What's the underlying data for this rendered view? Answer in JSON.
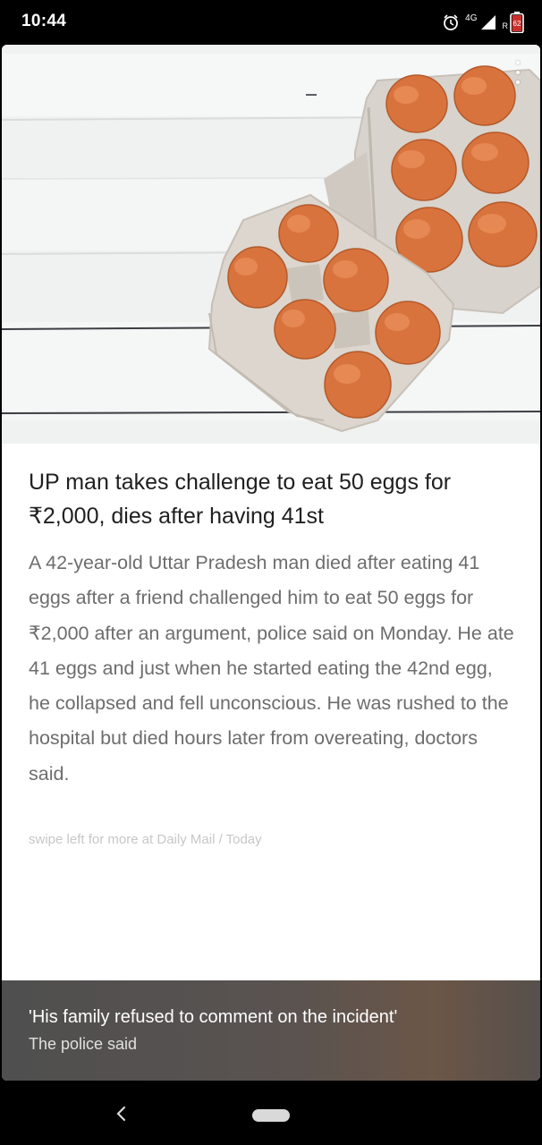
{
  "status_bar": {
    "time": "10:44",
    "network_label": "4G",
    "roaming_label": "R",
    "battery_level": "62",
    "icons": [
      "alarm-icon",
      "signal-icon",
      "battery-icon"
    ]
  },
  "article": {
    "image": {
      "description_icon": "eggs-in-carton-photo"
    },
    "headline": "UP man takes challenge to eat 50 eggs for ₹2,000, dies after having 41st",
    "body": "A 42-year-old Uttar Pradesh man died after eating 41 eggs after a friend challenged him to eat 50 eggs for ₹2,000 after an argument, police said on Monday. He ate 41 eggs and just when he started eating the 42nd egg, he collapsed and fell unconscious. He was rushed to the hospital but died hours later from overeating, doctors said.",
    "attribution": "swipe left for more at Daily Mail / Today"
  },
  "quote": {
    "text": "'His family refused to comment on the incident'",
    "source": "The police said"
  },
  "nav": {
    "icons": [
      "back-icon",
      "home-pill"
    ]
  },
  "colors": {
    "headline": "#202020",
    "body": "#6d6d6d",
    "attribution": "#c7c7c7",
    "quote_bg": "#555250",
    "egg": "#d9733d",
    "carton": "#d8d3cc"
  }
}
